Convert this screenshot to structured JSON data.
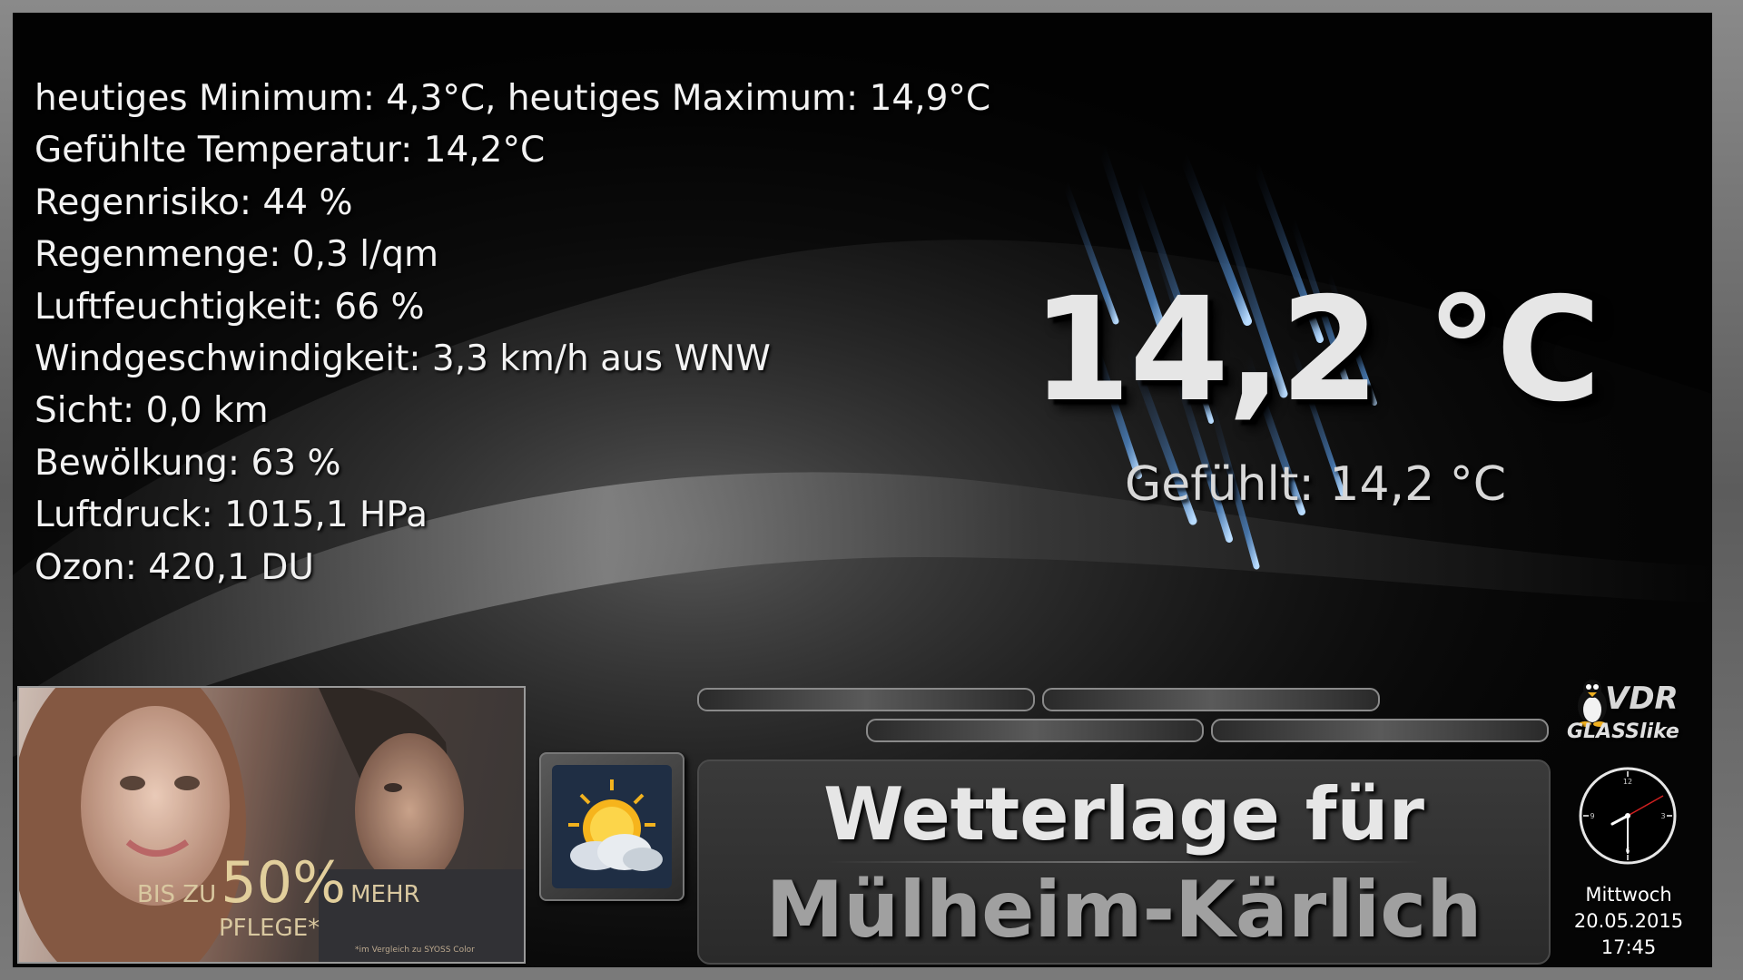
{
  "details": [
    "heutiges Minimum: 4,3°C, heutiges Maximum: 14,9°C",
    "Gefühlte Temperatur: 14,2°C",
    "Regenrisiko: 44 %",
    "Regenmenge: 0,3 l/qm",
    "Luftfeuchtigkeit: 66 %",
    "Windgeschwindigkeit: 3,3 km/h aus WNW",
    "Sicht: 0,0 km",
    "Bewölkung: 63 %",
    "Luftdruck: 1015,1 HPa",
    "Ozon: 420,1 DU"
  ],
  "current": {
    "temperature": "14,2 °C",
    "feels_like": "Gefühlt: 14,2 °C"
  },
  "advert": {
    "prefix": "BIS ZU",
    "big": "50%",
    "suffix": "MEHR",
    "line2": "PFLEGE*",
    "note": "*im Vergleich zu SYOSS Color"
  },
  "location": {
    "title": "Wetterlage für",
    "city": "Mülheim-Kärlich"
  },
  "logo": {
    "vdr": "VDR",
    "skin": "GLASSlike"
  },
  "status": {
    "weekday": "Mittwoch",
    "date": "20.05.2015",
    "time": "17:45"
  },
  "icons": {
    "weather": "partly-cloudy-sun-icon",
    "rain": "rain-streaks-icon",
    "clock": "analog-clock-icon",
    "mascot": "penguin-icon"
  },
  "colors": {
    "background": "#050505",
    "text": "#f2f2f2",
    "city": "#a0a0a0",
    "rain_accent": "#6fa8e0"
  }
}
